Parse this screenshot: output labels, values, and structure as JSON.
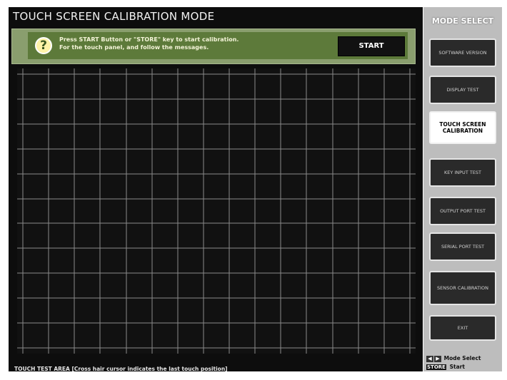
{
  "title": "TOUCH SCREEN CALIBRATION MODE",
  "banner": {
    "message_line1": "Press START Button or \"STORE\" key to start calibration.",
    "message_line2": "For the touch panel, and follow the messages.",
    "start_label": "START"
  },
  "footer_text": "TOUCH TEST AREA  [Cross hair cursor indicates the last touch position]",
  "sidebar": {
    "heading": "MODE SELECT",
    "buttons": [
      {
        "label": "SOFTWARE VERSION"
      },
      {
        "label": "DISPLAY TEST"
      },
      {
        "label": "TOUCH SCREEN CALIBRATION"
      },
      {
        "label": "KEY INPUT TEST"
      },
      {
        "label": "OUTPUT PORT TEST"
      },
      {
        "label": "SERIAL PORT TEST"
      },
      {
        "label": "SENSOR CALIBRATION"
      },
      {
        "label": "EXIT"
      }
    ],
    "footer_mode_select": "Mode Select",
    "footer_store": "STORE",
    "footer_start": "Start"
  },
  "colors": {
    "background": "#0d0d0d",
    "banner": "#5d7a3a",
    "grid": "#8a8a8a",
    "sidebar": "#bdbdbd"
  }
}
